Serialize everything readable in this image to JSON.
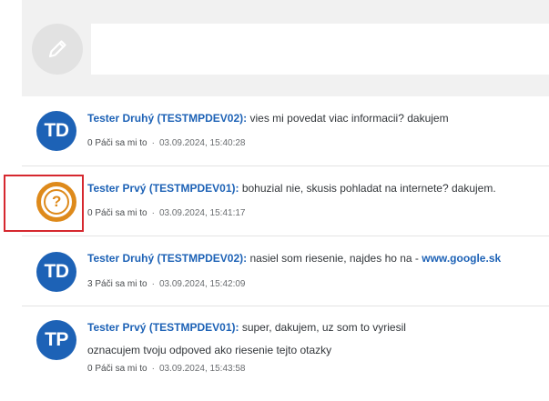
{
  "composer": {
    "avatar_icon": "pencil-icon"
  },
  "posts": [
    {
      "avatar": "TD",
      "author": "Tester Druhý (TESTMPDEV02):",
      "text": " vies mi povedat viac informacii? dakujem",
      "likes": "0 Páči sa mi to",
      "separator": "·",
      "timestamp": "03.09.2024, 15:40:28"
    },
    {
      "avatar": "?",
      "author": "Tester Prvý (TESTMPDEV01):",
      "text": " bohuzial nie, skusis pohladat na internete? dakujem.",
      "likes": "0 Páči sa mi to",
      "separator": "·",
      "timestamp": "03.09.2024, 15:41:17"
    },
    {
      "avatar": "TD",
      "author": "Tester Druhý (TESTMPDEV02):",
      "text": " nasiel som riesenie, najdes ho na - ",
      "link": "www.google.sk",
      "likes": "3 Páči sa mi to",
      "separator": "·",
      "timestamp": "03.09.2024, 15:42:09"
    },
    {
      "avatar": "TP",
      "author": "Tester Prvý (TESTMPDEV01):",
      "text": " super, dakujem, uz som to vyriesil",
      "text2": "oznacujem tvoju odpoved ako riesenie tejto otazky",
      "likes": "0 Páči sa mi to",
      "separator": "·",
      "timestamp": "03.09.2024, 15:43:58"
    }
  ],
  "colors": {
    "accent": "#1d62b6",
    "anon_avatar": "#de8a1b",
    "highlight": "#d6282f"
  }
}
